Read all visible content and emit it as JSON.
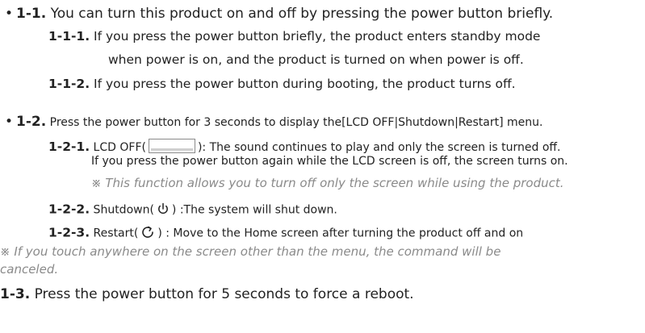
{
  "sections": {
    "s1_1": {
      "num": "1-1.",
      "text": " You can turn this product on and off by pressing the power button briefly."
    },
    "s1_1_1": {
      "num": "1-1-1.",
      "text": " If you press the power button briefly, the product enters standby mode",
      "text2": "when power is on, and the product is turned on when power is off."
    },
    "s1_1_2": {
      "num": "1-1-2.",
      "text": " If you press the power button during booting, the product turns off."
    },
    "s1_2": {
      "num": "1-2.",
      "text": " Press the power button for 3 seconds to display the[LCD OFF|Shutdown|Restart] menu."
    },
    "s1_2_1": {
      "num": "1-2-1.",
      "pre": " LCD OFF(",
      "post": "): The sound continues to play and only the screen is turned off.",
      "text2": "If you press the power button again while the LCD screen is off, the screen turns on.",
      "note": "※ This function allows you to turn off only the screen while using the product."
    },
    "s1_2_2": {
      "num": "1-2-2.",
      "pre": " Shutdown(",
      "post": ") :The system will shut down."
    },
    "s1_2_3": {
      "num": "1-2-3.",
      "pre": " Restart(",
      "post": ") : Move to the Home screen after turning the product off and on"
    },
    "cancel_note": {
      "line1": "※ If you touch anywhere on the screen other than the menu, the command will be",
      "line2": "canceled."
    },
    "s1_3": {
      "num": "1-3.",
      "text": " Press the power button for 5 seconds to force a reboot."
    }
  },
  "icons": {
    "lcd": "lcd-screen-icon",
    "power": "power-icon",
    "restart": "restart-icon"
  }
}
